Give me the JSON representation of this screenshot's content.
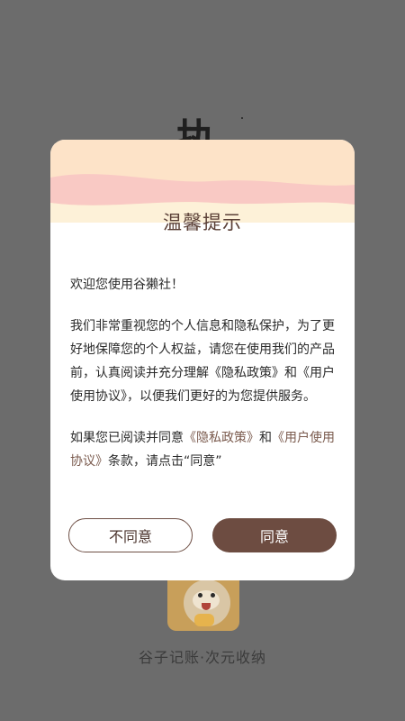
{
  "background": {
    "title_fragment": "执",
    "app_name": "谷子记账·次元收纳"
  },
  "dialog": {
    "title": "温馨提示",
    "greeting": "欢迎您使用谷獭社！",
    "paragraph1": "我们非常重视您的个人信息和隐私保护，为了更好地保障您的个人权益，请您在使用我们的产品前，认真阅读并充分理解《隐私政策》和《用户使用协议》，以便我们更好的为您提供服务。",
    "paragraph2": {
      "prefix": "如果您已阅读并同意",
      "privacy_link": "《隐私政策》",
      "middle": "和",
      "terms_link": "《用户使用协议》",
      "suffix": "条款，请点击“同意”"
    },
    "disagree_label": "不同意",
    "agree_label": "同意"
  },
  "colors": {
    "overlay": "#6c6c6c",
    "header_peach": "#fde3c8",
    "header_pink": "#f9c9c4",
    "header_cream": "#fdf1d8",
    "accent_brown": "#6d4c41",
    "title_brown": "#5a3f36"
  },
  "icons": {
    "app_icon": "otter-mascot-icon"
  }
}
